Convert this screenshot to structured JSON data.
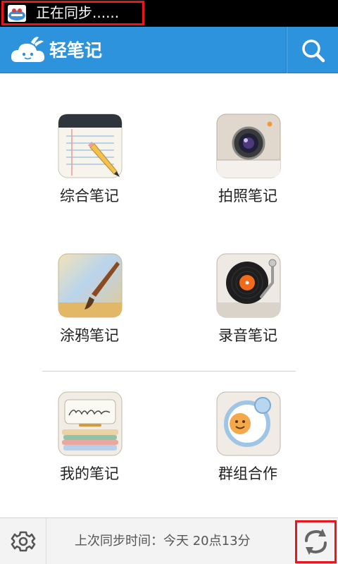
{
  "status_bar": {
    "sync_status": "正在同步......"
  },
  "header": {
    "app_title": "轻笔记",
    "brand_color": "#2e93dd",
    "logo_icon": "cloud-rabbit-logo-icon",
    "search_icon": "search-icon"
  },
  "grid": {
    "items": [
      {
        "label": "综合笔记",
        "icon": "notepad-pencil-icon"
      },
      {
        "label": "拍照笔记",
        "icon": "camera-icon"
      },
      {
        "label": "涂鸦笔记",
        "icon": "paintbrush-icon"
      },
      {
        "label": "录音笔记",
        "icon": "record-player-icon"
      },
      {
        "label": "我的笔记",
        "icon": "notes-stack-icon"
      },
      {
        "label": "群组合作",
        "icon": "group-smiley-icon"
      }
    ]
  },
  "bottom_bar": {
    "last_sync": "上次同步时间：今天 20点13分",
    "settings_icon": "gear-icon",
    "sync_icon": "refresh-icon"
  }
}
